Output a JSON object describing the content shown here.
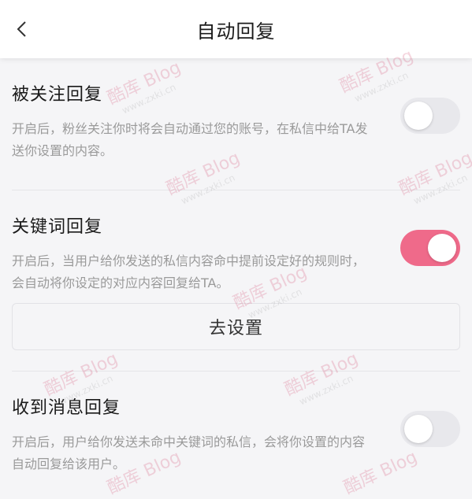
{
  "header": {
    "back_icon": "chevron-left-icon",
    "title": "自动回复"
  },
  "sections": [
    {
      "title": "被关注回复",
      "description": "开启后，粉丝关注你时将会自动通过您的账号，在私信中给TA发送你设置的内容。",
      "toggle_state": "off"
    },
    {
      "title": "关键词回复",
      "description": "开启后，当用户给你发送的私信内容命中提前设定好的规则时，会自动将你设定的对应内容回复给TA。",
      "toggle_state": "on"
    },
    {
      "title": "收到消息回复",
      "description": "开启后，用户给你发送未命中关键词的私信，会将你设置的内容自动回复给该用户。",
      "toggle_state": "off"
    }
  ],
  "keyword_settings_button": "去设置",
  "watermark": {
    "main": "酷库 Blog",
    "sub": "www.zxki.cn"
  },
  "colors": {
    "toggle_on": "#ef6a8a",
    "toggle_off": "#e8e8ec",
    "background": "#f5f5f7"
  }
}
